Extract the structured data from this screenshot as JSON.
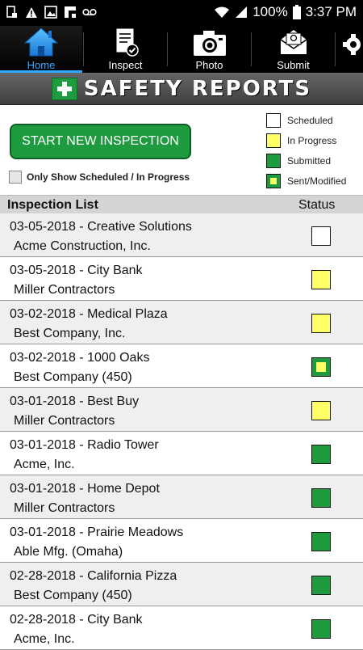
{
  "statusbar": {
    "battery": "100%",
    "time": "3:37 PM"
  },
  "nav": {
    "home": "Home",
    "inspect": "Inspect",
    "photo": "Photo",
    "submit": "Submit"
  },
  "banner": {
    "title": "SAFETY REPORTS"
  },
  "controls": {
    "start_button": "START NEW INSPECTION",
    "filter_label": "Only Show Scheduled / In Progress"
  },
  "legend": {
    "scheduled": "Scheduled",
    "in_progress": "In Progress",
    "submitted": "Submitted",
    "sent": "Sent/Modified"
  },
  "list": {
    "header_left": "Inspection List",
    "header_right": "Status",
    "rows": [
      {
        "title": "03-05-2018 - Creative Solutions",
        "company": "Acme Construction, Inc.",
        "status": "scheduled"
      },
      {
        "title": "03-05-2018 - City Bank",
        "company": "Miller Contractors",
        "status": "progress"
      },
      {
        "title": "03-02-2018 - Medical Plaza",
        "company": "Best Company, Inc.",
        "status": "progress"
      },
      {
        "title": "03-02-2018 - 1000 Oaks",
        "company": "Best Company (450)",
        "status": "sent"
      },
      {
        "title": "03-01-2018 - Best Buy",
        "company": "Miller Contractors",
        "status": "progress"
      },
      {
        "title": "03-01-2018 - Radio Tower",
        "company": "Acme, Inc.",
        "status": "submitted"
      },
      {
        "title": "03-01-2018 - Home Depot",
        "company": "Miller Contractors",
        "status": "submitted"
      },
      {
        "title": "03-01-2018 - Prairie Meadows",
        "company": "Able Mfg. (Omaha)",
        "status": "submitted"
      },
      {
        "title": "02-28-2018 - California Pizza",
        "company": "Best Company (450)",
        "status": "submitted"
      },
      {
        "title": "02-28-2018 - City Bank",
        "company": "Acme, Inc.",
        "status": "submitted"
      }
    ]
  },
  "colors": {
    "accent_green": "#1e9b3e",
    "progress_yellow": "#ffff66",
    "nav_active": "#3aa8ff"
  }
}
